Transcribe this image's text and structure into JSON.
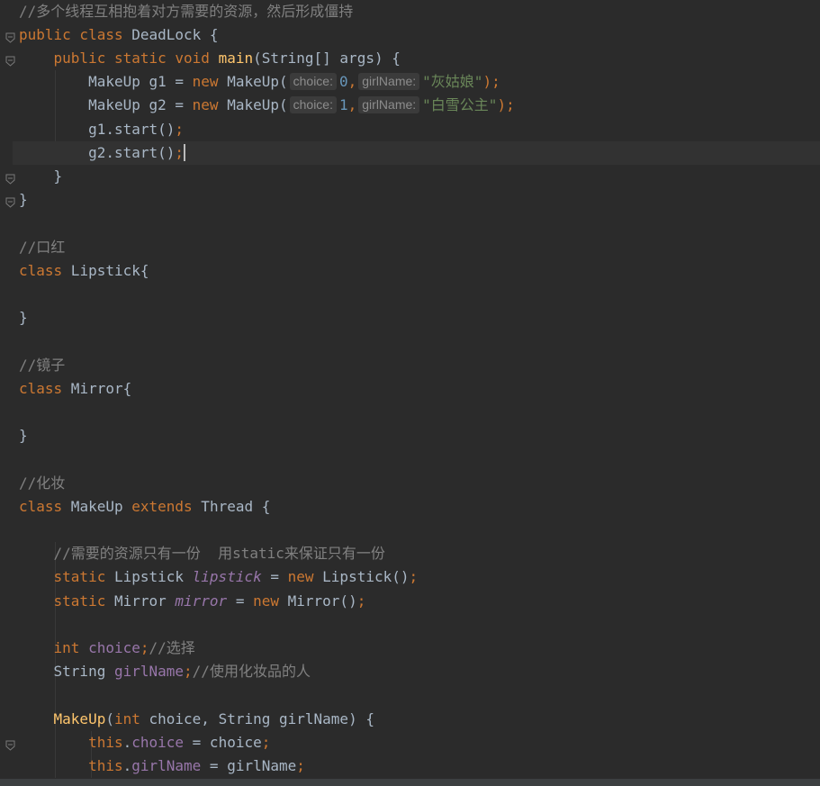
{
  "editor": {
    "lines": [
      [
        {
          "t": "//多个线程互相抱着对方需要的资源，然后形成僵持",
          "c": "cmt"
        }
      ],
      [
        {
          "t": "public class",
          "c": "kw"
        },
        {
          "t": " DeadLock {",
          "c": ""
        }
      ],
      [
        {
          "t": "    ",
          "c": ""
        },
        {
          "t": "public static void",
          "c": "kw"
        },
        {
          "t": " ",
          "c": ""
        },
        {
          "t": "main",
          "c": "fn"
        },
        {
          "t": "(String[] args) {",
          "c": ""
        }
      ],
      [
        {
          "t": "        MakeUp g1 = ",
          "c": ""
        },
        {
          "t": "new",
          "c": "kw"
        },
        {
          "t": " MakeUp(",
          "c": ""
        },
        {
          "t": "choice:",
          "c": "hint"
        },
        {
          "t": "0",
          "c": "num"
        },
        {
          "t": ",",
          "c": "kw"
        },
        {
          "t": "girlName:",
          "c": "hint"
        },
        {
          "t": "\"灰姑娘\"",
          "c": "str"
        },
        {
          "t": ");",
          "c": "semi"
        }
      ],
      [
        {
          "t": "        MakeUp g2 = ",
          "c": ""
        },
        {
          "t": "new",
          "c": "kw"
        },
        {
          "t": " MakeUp(",
          "c": ""
        },
        {
          "t": "choice:",
          "c": "hint"
        },
        {
          "t": "1",
          "c": "num"
        },
        {
          "t": ",",
          "c": "kw"
        },
        {
          "t": "girlName:",
          "c": "hint"
        },
        {
          "t": "\"白雪公主\"",
          "c": "str"
        },
        {
          "t": ");",
          "c": "semi"
        }
      ],
      [
        {
          "t": "        g1.start()",
          "c": ""
        },
        {
          "t": ";",
          "c": "semi"
        }
      ],
      [
        {
          "t": "        g2.start()",
          "c": ""
        },
        {
          "t": ";",
          "c": "semi"
        }
      ],
      [
        {
          "t": "    }",
          "c": ""
        }
      ],
      [
        {
          "t": "}",
          "c": ""
        }
      ],
      [],
      [
        {
          "t": "//口红",
          "c": "cmt"
        }
      ],
      [
        {
          "t": "class",
          "c": "kw"
        },
        {
          "t": " Lipstick{",
          "c": ""
        }
      ],
      [],
      [
        {
          "t": "}",
          "c": ""
        }
      ],
      [],
      [
        {
          "t": "//镜子",
          "c": "cmt"
        }
      ],
      [
        {
          "t": "class",
          "c": "kw"
        },
        {
          "t": " Mirror{",
          "c": ""
        }
      ],
      [],
      [
        {
          "t": "}",
          "c": ""
        }
      ],
      [],
      [
        {
          "t": "//化妆",
          "c": "cmt"
        }
      ],
      [
        {
          "t": "class",
          "c": "kw"
        },
        {
          "t": " MakeUp ",
          "c": ""
        },
        {
          "t": "extends",
          "c": "kw"
        },
        {
          "t": " Thread {",
          "c": ""
        }
      ],
      [],
      [
        {
          "t": "    //需要的资源只有一份  用static来保证只有一份",
          "c": "cmt"
        }
      ],
      [
        {
          "t": "    ",
          "c": ""
        },
        {
          "t": "static",
          "c": "kw"
        },
        {
          "t": " Lipstick ",
          "c": ""
        },
        {
          "t": "lipstick",
          "c": "sfld"
        },
        {
          "t": " = ",
          "c": ""
        },
        {
          "t": "new",
          "c": "kw"
        },
        {
          "t": " Lipstick()",
          "c": ""
        },
        {
          "t": ";",
          "c": "semi"
        }
      ],
      [
        {
          "t": "    ",
          "c": ""
        },
        {
          "t": "static",
          "c": "kw"
        },
        {
          "t": " Mirror ",
          "c": ""
        },
        {
          "t": "mirror",
          "c": "sfld"
        },
        {
          "t": " = ",
          "c": ""
        },
        {
          "t": "new",
          "c": "kw"
        },
        {
          "t": " Mirror()",
          "c": ""
        },
        {
          "t": ";",
          "c": "semi"
        }
      ],
      [],
      [
        {
          "t": "    ",
          "c": ""
        },
        {
          "t": "int",
          "c": "kw"
        },
        {
          "t": " ",
          "c": ""
        },
        {
          "t": "choice",
          "c": "fld"
        },
        {
          "t": ";",
          "c": "semi"
        },
        {
          "t": "//选择",
          "c": "cmt"
        }
      ],
      [
        {
          "t": "    String ",
          "c": ""
        },
        {
          "t": "girlName",
          "c": "fld"
        },
        {
          "t": ";",
          "c": "semi"
        },
        {
          "t": "//使用化妆品的人",
          "c": "cmt"
        }
      ],
      [],
      [
        {
          "t": "    ",
          "c": ""
        },
        {
          "t": "MakeUp",
          "c": "fn"
        },
        {
          "t": "(",
          "c": ""
        },
        {
          "t": "int",
          "c": "kw"
        },
        {
          "t": " choice, String girlName) {",
          "c": ""
        }
      ],
      [
        {
          "t": "        ",
          "c": ""
        },
        {
          "t": "this",
          "c": "kw"
        },
        {
          "t": ".",
          "c": ""
        },
        {
          "t": "choice",
          "c": "fld"
        },
        {
          "t": " = choice",
          "c": ""
        },
        {
          "t": ";",
          "c": "semi"
        }
      ],
      [
        {
          "t": "        ",
          "c": ""
        },
        {
          "t": "this",
          "c": "kw"
        },
        {
          "t": ".",
          "c": ""
        },
        {
          "t": "girlName",
          "c": "fld"
        },
        {
          "t": " = girlName",
          "c": ""
        },
        {
          "t": ";",
          "c": "semi"
        }
      ]
    ],
    "current_line": 6,
    "fold_lines": [
      1,
      2,
      7,
      8,
      31
    ],
    "colors": {
      "background": "#2b2b2b",
      "keyword": "#cc7832",
      "comment": "#808080",
      "string": "#6a8759",
      "number": "#6897bb",
      "function": "#ffc66d",
      "field": "#9876aa"
    }
  }
}
